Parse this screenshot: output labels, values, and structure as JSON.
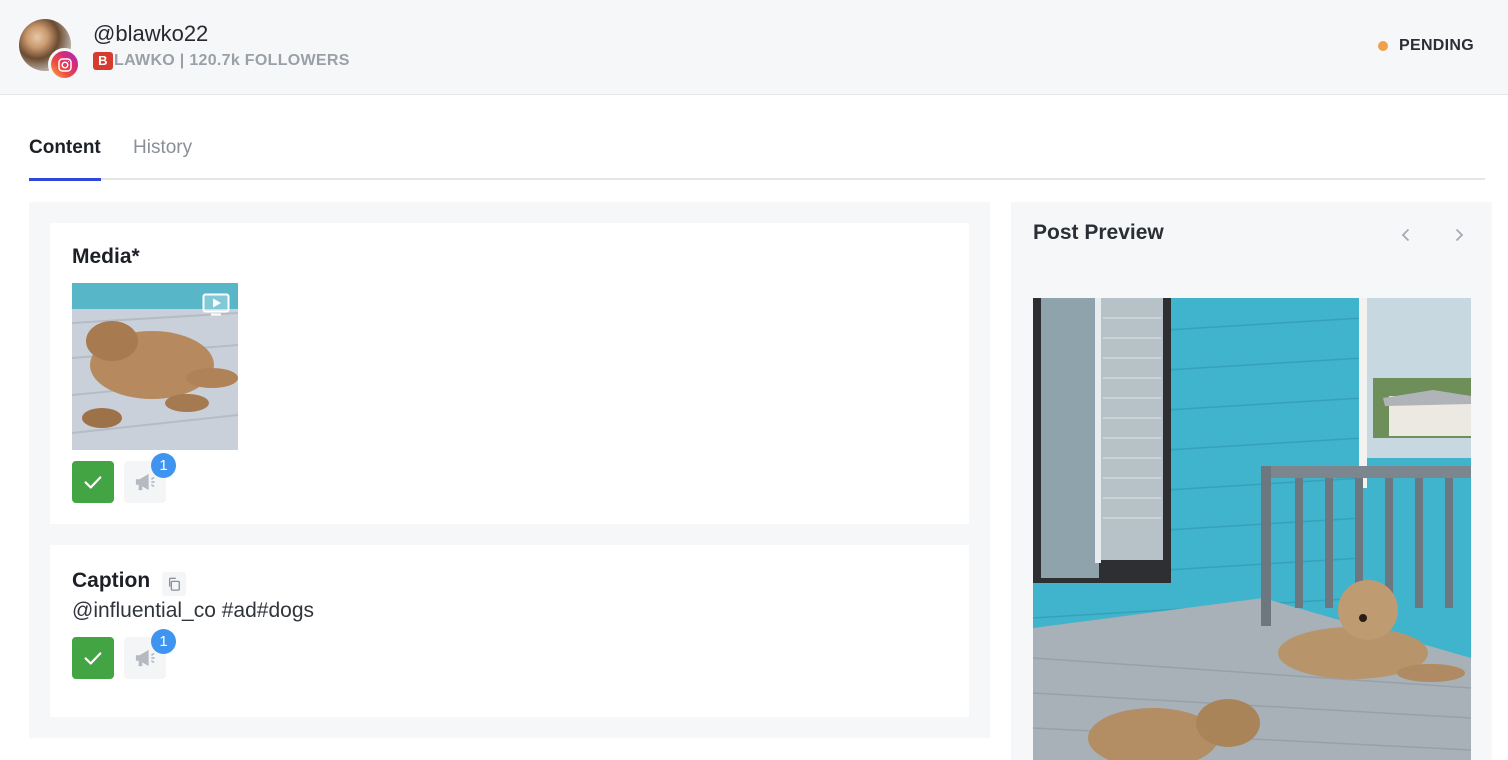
{
  "header": {
    "handle": "@blawko22",
    "brand_letter": "B",
    "subtitle": "LAWKO | 120.7k FOLLOWERS",
    "status": "PENDING",
    "status_color": "#f0a04b",
    "platform_icon": "instagram-icon"
  },
  "tabs": [
    {
      "label": "Content",
      "active": true
    },
    {
      "label": "History",
      "active": false
    }
  ],
  "media_card": {
    "title": "Media*",
    "approve_icon": "check-icon",
    "comment_icon": "megaphone-icon",
    "comment_count": "1"
  },
  "caption_card": {
    "title": "Caption",
    "text": "@influential_co #ad#dogs",
    "copy_icon": "copy-icon",
    "approve_icon": "check-icon",
    "comment_icon": "megaphone-icon",
    "comment_count": "1"
  },
  "preview": {
    "title": "Post Preview",
    "prev_icon": "chevron-left-icon",
    "next_icon": "chevron-right-icon"
  },
  "colors": {
    "accent": "#2f48d8",
    "approve": "#43a444",
    "badge": "#3e94ee"
  }
}
